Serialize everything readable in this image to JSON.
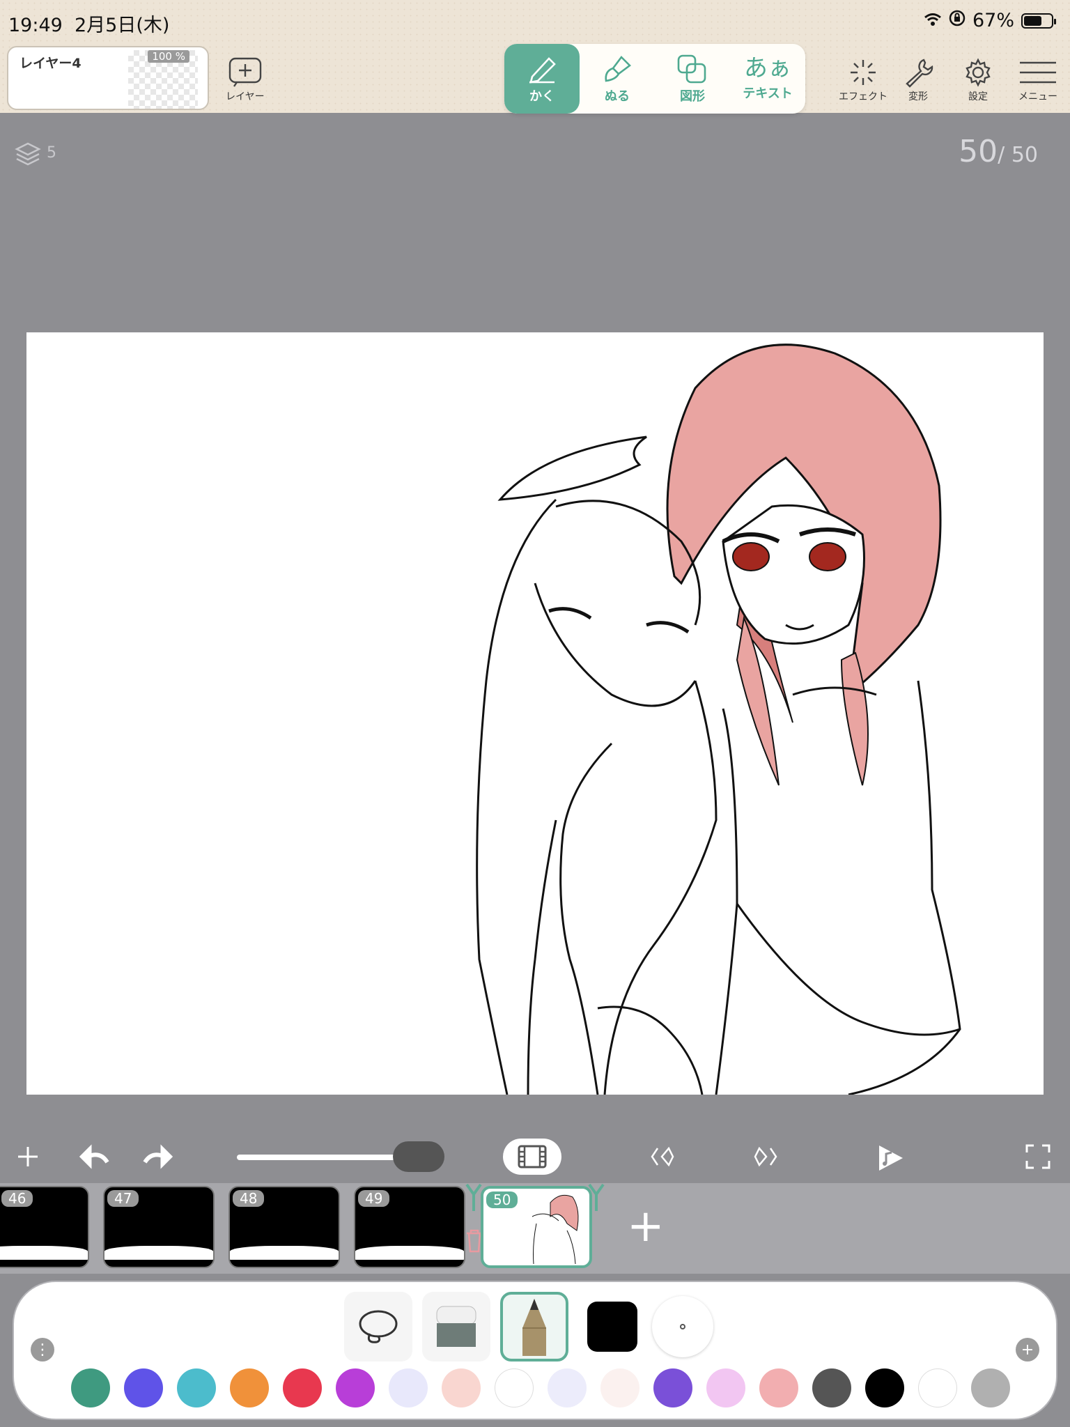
{
  "status": {
    "time": "19:49",
    "date": "2月5日(木)",
    "battery": "67%"
  },
  "layer": {
    "name": "レイヤー4",
    "opacity": "100 %",
    "add_label": "レイヤー"
  },
  "modes": [
    {
      "label": "かく",
      "icon": "pencil-icon"
    },
    {
      "label": "ぬる",
      "icon": "brush-icon"
    },
    {
      "label": "図形",
      "icon": "shapes-icon"
    },
    {
      "label": "テキスト",
      "glyph": "あぁ"
    }
  ],
  "right_tools": [
    {
      "label": "エフェクト",
      "icon": "sparkle-icon"
    },
    {
      "label": "変形",
      "icon": "wrench-icon"
    },
    {
      "label": "設定",
      "icon": "gear-icon"
    },
    {
      "label": "メニュー",
      "icon": "hamburger-icon"
    }
  ],
  "canvas": {
    "layer_count": "5",
    "current_frame": "50",
    "total_frames": "/ 50"
  },
  "timeline": {
    "frames": [
      {
        "num": "46"
      },
      {
        "num": "47"
      },
      {
        "num": "48"
      },
      {
        "num": "49"
      },
      {
        "num": "50",
        "current": true
      }
    ],
    "add_label": "+"
  },
  "palette": {
    "colors": [
      "#3f9a80",
      "#5f53e8",
      "#4cbccc",
      "#f0913a",
      "#e8384f",
      "#b83ed8",
      "#e8e8fb",
      "#f9d6d0",
      "#ffffff",
      "#ececfb",
      "#fbf1ef",
      "#7a50d8",
      "#f2c6f2",
      "#f2aeb0",
      "#555555",
      "#000000",
      "#ffffff",
      "#b0b0b0"
    ],
    "current_color": "#000000"
  }
}
